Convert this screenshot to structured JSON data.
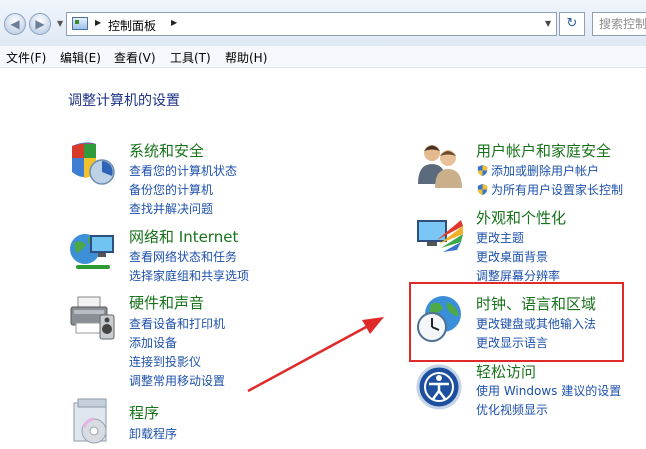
{
  "address_bar": {
    "breadcrumb": "控制面板",
    "search_placeholder": "搜索控制面板"
  },
  "menu": [
    "文件(F)",
    "编辑(E)",
    "查看(V)",
    "工具(T)",
    "帮助(H)"
  ],
  "page_title": "调整计算机的设置",
  "left_categories": [
    {
      "title": "系统和安全",
      "links": [
        "查看您的计算机状态",
        "备份您的计算机",
        "查找并解决问题"
      ]
    },
    {
      "title": "网络和 Internet",
      "links": [
        "查看网络状态和任务",
        "选择家庭组和共享选项"
      ]
    },
    {
      "title": "硬件和声音",
      "links": [
        "查看设备和打印机",
        "添加设备",
        "连接到投影仪",
        "调整常用移动设置"
      ]
    },
    {
      "title": "程序",
      "links": [
        "卸载程序"
      ]
    }
  ],
  "right_categories": [
    {
      "title": "用户帐户和家庭安全",
      "links": [
        "添加或删除用户帐户",
        "为所有用户设置家长控制"
      ]
    },
    {
      "title": "外观和个性化",
      "links": [
        "更改主题",
        "更改桌面背景",
        "调整屏幕分辨率"
      ]
    },
    {
      "title": "时钟、语言和区域",
      "links": [
        "更改键盘或其他输入法",
        "更改显示语言"
      ]
    },
    {
      "title": "轻松访问",
      "links": [
        "使用 Windows 建议的设置",
        "优化视频显示"
      ]
    }
  ],
  "annotation_color": "#e02929"
}
